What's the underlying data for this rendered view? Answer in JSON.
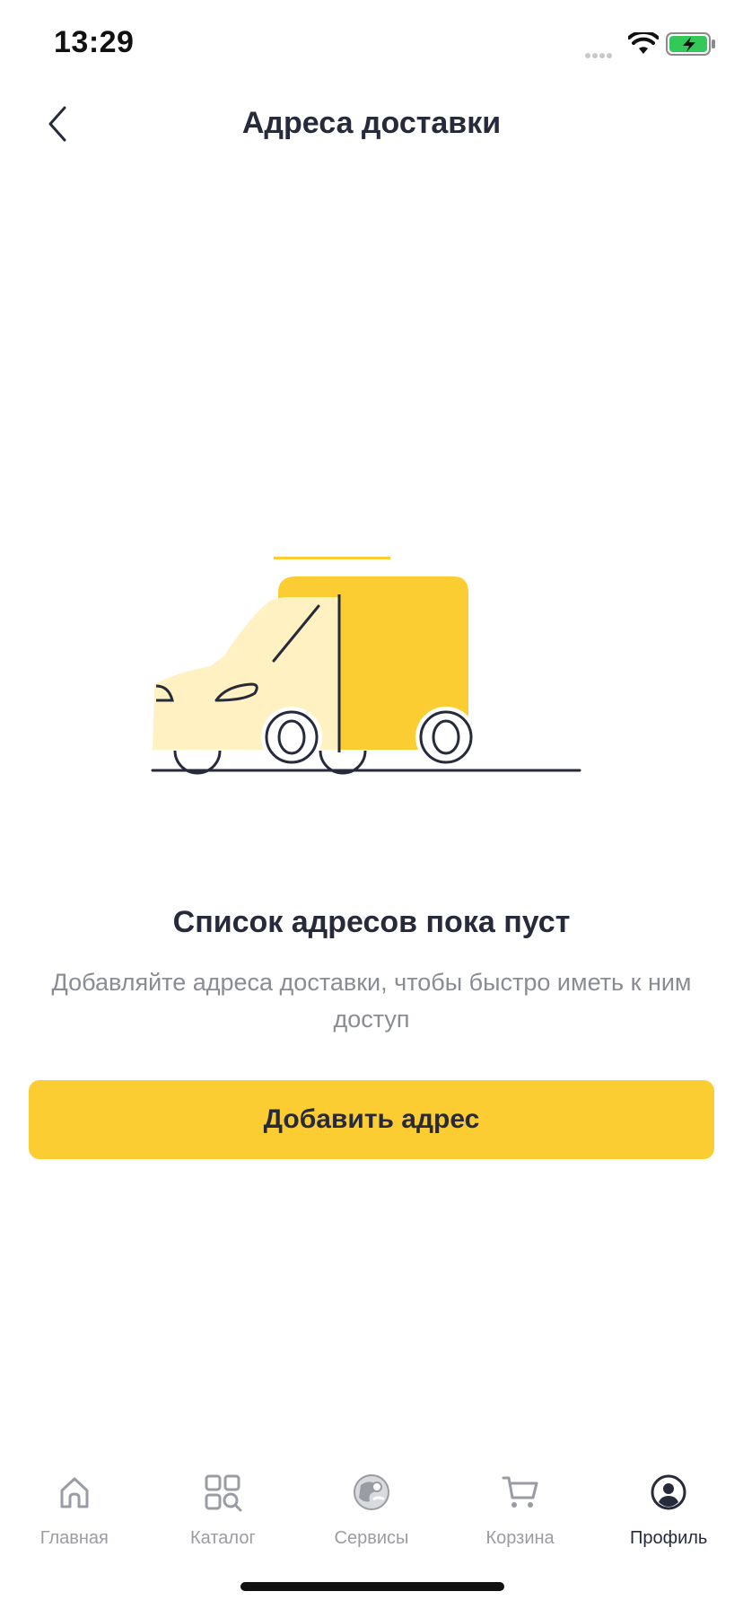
{
  "status_bar": {
    "time": "13:29",
    "icons": [
      "signal-icon",
      "wifi-icon",
      "battery-charging-icon"
    ]
  },
  "nav": {
    "title": "Адреса доставки",
    "back_icon": "chevron-left-icon"
  },
  "illustration": {
    "name": "delivery-truck-illustration",
    "colors": {
      "primary": "#fccc33",
      "light": "#fff1c2",
      "outline": "#272a3a"
    }
  },
  "empty_state": {
    "title": "Список адресов пока пуст",
    "subtitle": "Добавляйте адреса доставки, чтобы быстро иметь к ним доступ"
  },
  "actions": {
    "add_address_label": "Добавить адрес"
  },
  "tab_bar": {
    "tabs": [
      {
        "label": "Главная",
        "icon": "home-icon",
        "active": false
      },
      {
        "label": "Каталог",
        "icon": "catalog-icon",
        "active": false
      },
      {
        "label": "Сервисы",
        "icon": "services-icon",
        "active": false
      },
      {
        "label": "Корзина",
        "icon": "cart-icon",
        "active": false
      },
      {
        "label": "Профиль",
        "icon": "profile-icon",
        "active": true
      }
    ]
  },
  "colors": {
    "accent": "#fccc33",
    "text_primary": "#272a3a",
    "text_secondary": "#8a8c94",
    "tab_inactive": "#9a9ca3"
  }
}
